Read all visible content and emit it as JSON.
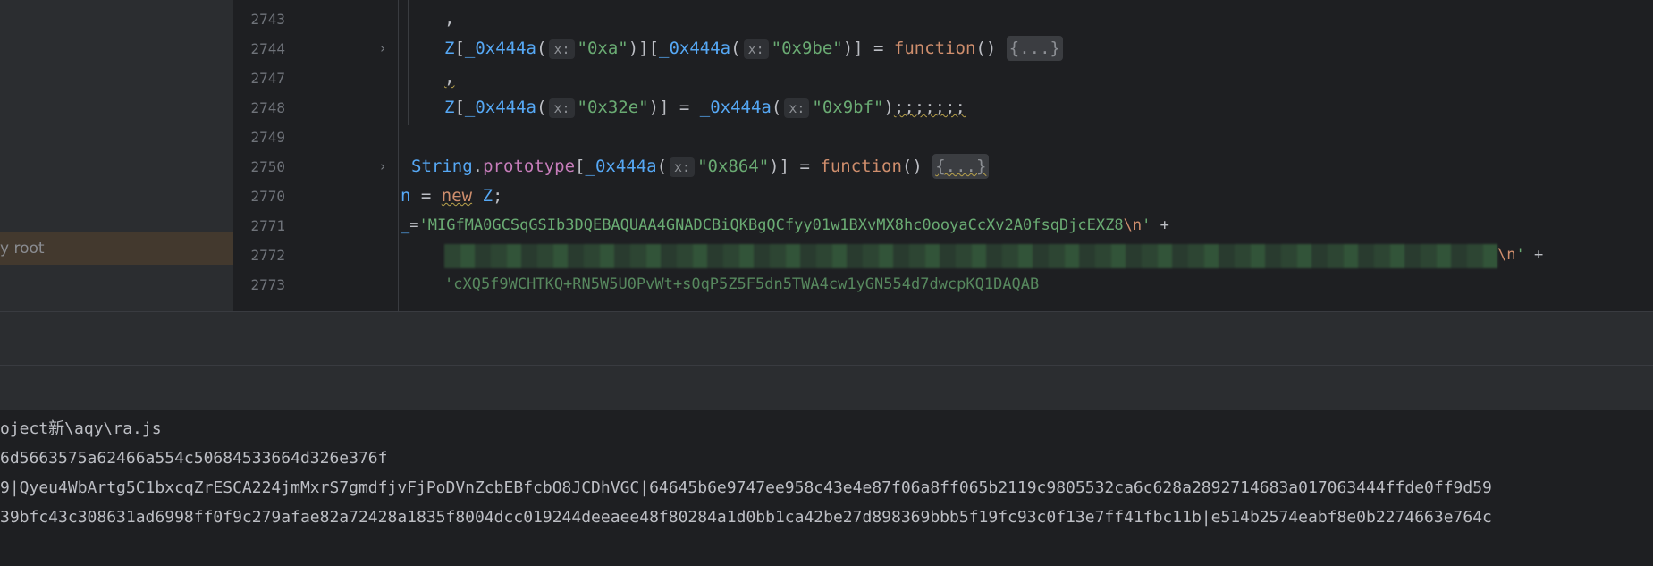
{
  "tree": {
    "root_label": "y root"
  },
  "editor": {
    "lines": [
      {
        "num": "2743"
      },
      {
        "num": "2744"
      },
      {
        "num": "2747"
      },
      {
        "num": "2748"
      },
      {
        "num": "2749"
      },
      {
        "num": "2750"
      },
      {
        "num": "2770"
      },
      {
        "num": "2771"
      },
      {
        "num": "2772"
      },
      {
        "num": "2773"
      }
    ],
    "code": {
      "l2743": ",",
      "l2744_z": "Z",
      "l2744_fn1": "_0x444a",
      "l2744_hint": "x:",
      "l2744_s1": "\"0xa\"",
      "l2744_fn2": "_0x444a",
      "l2744_s2": "\"0x9be\"",
      "l2744_kw": "function",
      "l2744_fold": "{...}",
      "l2747": ",",
      "l2748_z": "Z",
      "l2748_fn1": "_0x444a",
      "l2748_s1": "\"0x32e\"",
      "l2748_fn2": "_0x444a",
      "l2748_s2": "\"0x9bf\"",
      "l2748_tail": ";;;;;;;",
      "l2750_cls": "String",
      "l2750_field": "prototype",
      "l2750_fn": "_0x444a",
      "l2750_s": "\"0x864\"",
      "l2750_kw": "function",
      "l2750_fold": "{...}",
      "l2770_n": "n",
      "l2770_kw": "new",
      "l2770_z": "Z",
      "l2771_var": "_",
      "l2771_str": "'MIGfMA0GCSqGSIb3DQEBAQUAA4GNADCBiQKBgQCfyy01w1BXvMX8hc0ooyaCcXv2A0fsqDjcEXZ8",
      "l2771_esc": "\\n",
      "l2772_esc": "\\n",
      "l2773_str": "'cXQ5f9WCHTKQ+RN5W5U0PvWt+s0qP5Z5F5dn5TWA4cw1yGN554d7dwcpKQ1DAQAB",
      "plus": "+"
    }
  },
  "console": {
    "lines": [
      "oject新\\aqy\\ra.js",
      "6d5663575a62466a554c50684533664d326e376f",
      "9|Qyeu4WbArtg5C1bxcqZrESCA224jmMxrS7gmdfjvFjPoDVnZcbEBfcbO8JCDhVGC|64645b6e9747ee958c43e4e87f06a8ff065b2119c9805532ca6c628a2892714683a017063444ffde0ff9d59",
      "39bfc43c308631ad6998ff0f9c279afae82a72428a1835f8004dcc019244deeaee48f80284a1d0bb1ca42be27d898369bbb5f19fc93c0f13e7ff41fbc11b|e514b2574eabf8e0b2274663e764c"
    ]
  }
}
